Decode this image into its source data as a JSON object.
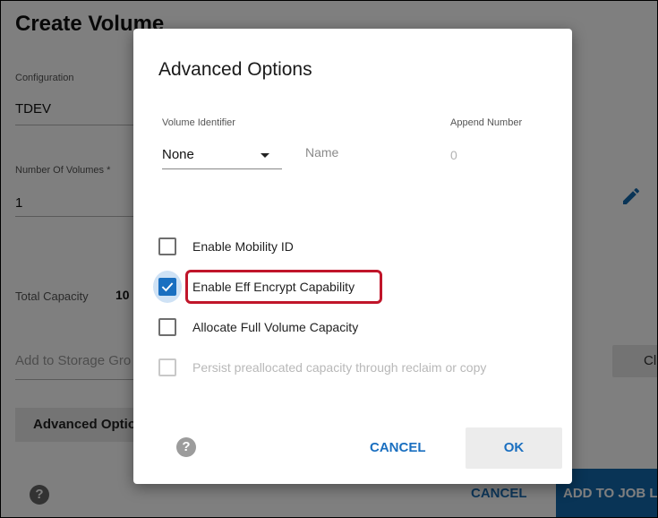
{
  "background": {
    "title": "Create Volume",
    "configuration_label": "Configuration",
    "configuration_value": "TDEV",
    "num_volumes_label": "Number Of Volumes *",
    "num_volumes_value": "1",
    "total_capacity_label": "Total Capacity",
    "total_capacity_value": "10",
    "add_storage_placeholder": "Add to Storage Gro",
    "clear_button": "Cl",
    "advanced_button": "Advanced Option",
    "help_icon": "?",
    "cancel_button": "CANCEL",
    "add_to_job_button": "ADD TO JOB L"
  },
  "dialog": {
    "title": "Advanced Options",
    "volume_identifier_label": "Volume Identifier",
    "volume_identifier_value": "None",
    "name_placeholder": "Name",
    "append_number_label": "Append Number",
    "append_number_value": "0",
    "options": [
      {
        "label": "Enable Mobility ID",
        "checked": false,
        "disabled": false
      },
      {
        "label": "Enable Eff Encrypt Capability",
        "checked": true,
        "disabled": false
      },
      {
        "label": "Allocate Full Volume Capacity",
        "checked": false,
        "disabled": false
      },
      {
        "label": "Persist preallocated capacity through reclaim or copy",
        "checked": false,
        "disabled": true
      }
    ],
    "help_icon": "?",
    "cancel_button": "CANCEL",
    "ok_button": "OK"
  },
  "colors": {
    "accent": "#1a6fc0",
    "highlight": "#c0152a"
  }
}
